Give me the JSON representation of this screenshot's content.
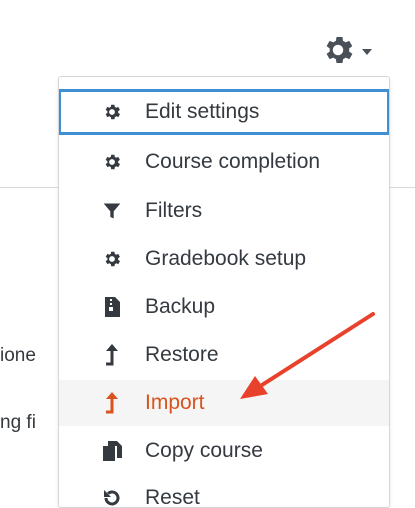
{
  "menu": {
    "items": [
      {
        "label": "Edit settings",
        "icon": "gear-icon"
      },
      {
        "label": "Course completion",
        "icon": "gear-icon"
      },
      {
        "label": "Filters",
        "icon": "filter-icon"
      },
      {
        "label": "Gradebook setup",
        "icon": "gear-icon"
      },
      {
        "label": "Backup",
        "icon": "archive-file-icon"
      },
      {
        "label": "Restore",
        "icon": "level-up-icon"
      },
      {
        "label": "Import",
        "icon": "level-up-icon"
      },
      {
        "label": "Copy course",
        "icon": "copy-icon"
      },
      {
        "label": "Reset",
        "icon": "undo-icon"
      }
    ]
  },
  "background": {
    "fragment_1": "ione",
    "fragment_2": "ng fi"
  },
  "colors": {
    "accent_orange": "#d9531e",
    "focus_blue": "#3f8fd6",
    "annotation_red": "#e8412c"
  }
}
